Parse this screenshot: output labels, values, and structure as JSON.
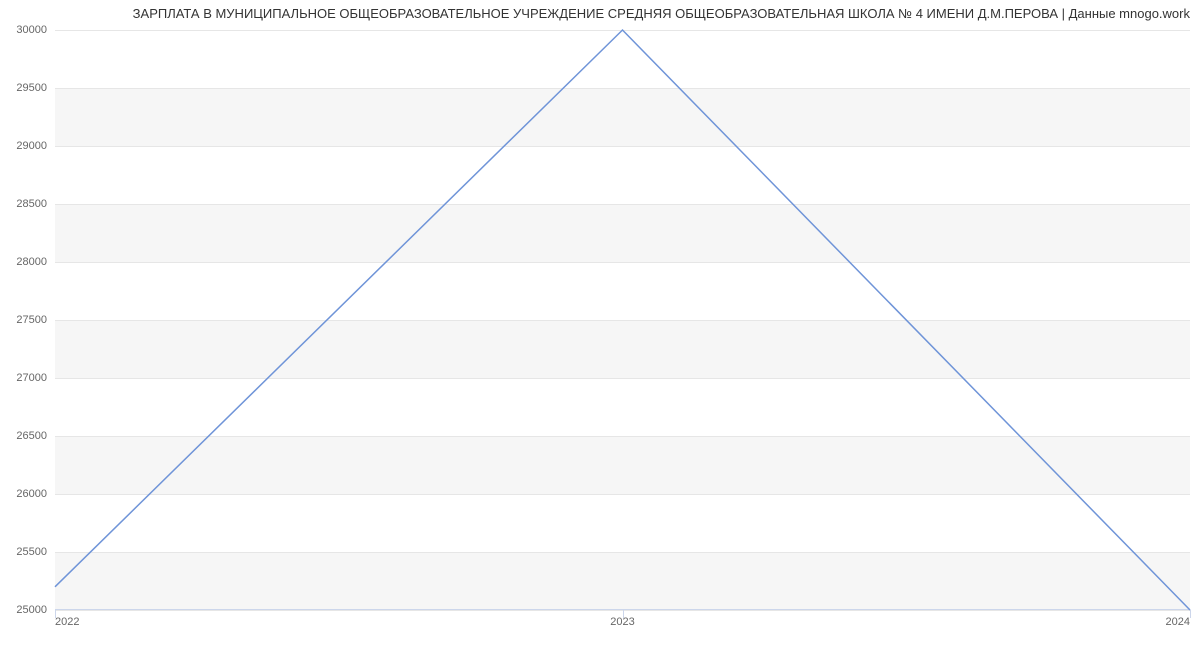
{
  "chart_data": {
    "type": "line",
    "title": "ЗАРПЛАТА В МУНИЦИПАЛЬНОЕ ОБЩЕОБРАЗОВАТЕЛЬНОЕ УЧРЕЖДЕНИЕ СРЕДНЯЯ ОБЩЕОБРАЗОВАТЕЛЬНАЯ ШКОЛА № 4 ИМЕНИ Д.М.ПЕРОВА | Данные mnogo.work",
    "xlabel": "",
    "ylabel": "",
    "x": [
      "2022",
      "2023",
      "2024"
    ],
    "values": [
      25200,
      30000,
      25000
    ],
    "y_ticks": [
      25000,
      25500,
      26000,
      26500,
      27000,
      27500,
      28000,
      28500,
      29000,
      29500,
      30000
    ],
    "ylim": [
      25000,
      30000
    ],
    "line_color": "#6f94d8"
  }
}
